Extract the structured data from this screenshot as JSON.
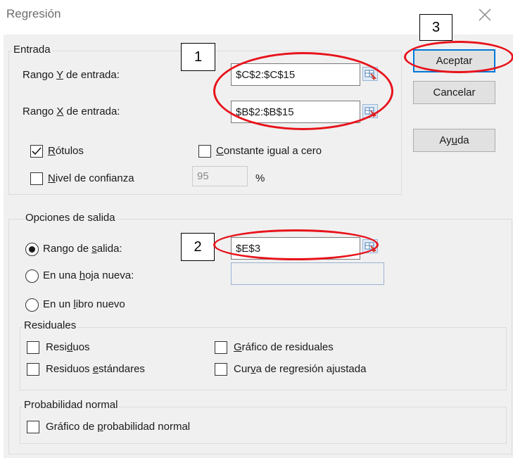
{
  "window": {
    "title": "Regresión"
  },
  "input_group": {
    "legend": "Entrada",
    "y_range": {
      "label_pre": "Rango ",
      "label_key": "Y",
      "label_post": " de entrada:",
      "value": "$C$2:$C$15"
    },
    "x_range": {
      "label_pre": "Rango ",
      "label_key": "X",
      "label_post": " de entrada:",
      "value": "$B$2:$B$15"
    },
    "labels_checkbox": {
      "label_key": "R",
      "label_rest": "ótulos",
      "checked": true
    },
    "constant_zero_checkbox": {
      "label_key": "C",
      "label_rest": "onstante igual a cero",
      "checked": false
    },
    "confidence_checkbox": {
      "label_key": "N",
      "label_rest": "ivel de confianza",
      "checked": false
    },
    "confidence_value": "95",
    "percent_sign": "%"
  },
  "buttons": {
    "accept": "Aceptar",
    "cancel": "Cancelar",
    "help_pre": "Ay",
    "help_key": "u",
    "help_post": "da"
  },
  "output_group": {
    "legend": "Opciones de salida",
    "output_range": {
      "label_pre": "Rango de ",
      "label_key": "s",
      "label_post": "alida:",
      "value": "$E$3",
      "selected": true
    },
    "new_sheet": {
      "label_pre": "En una ",
      "label_key": "h",
      "label_post": "oja nueva:",
      "value": "",
      "selected": false
    },
    "new_book": {
      "label_pre": "En un ",
      "label_key": "l",
      "label_post": "ibro nuevo",
      "selected": false
    }
  },
  "residuals_group": {
    "legend": "Residuales",
    "residuals": {
      "label_pre": "Resi",
      "label_key": "d",
      "label_post": "uos",
      "checked": false
    },
    "std_residuals": {
      "label_pre": "Residuos ",
      "label_key": "e",
      "label_post": "stándares",
      "checked": false
    },
    "residual_plot": {
      "label_pre": "",
      "label_key": "G",
      "label_post": "ráfico de residuales",
      "checked": false
    },
    "fit_line_plot": {
      "label_pre": "Cur",
      "label_key": "v",
      "label_post": "a de regresión ajustada",
      "checked": false
    }
  },
  "normal_group": {
    "legend": "Probabilidad normal",
    "normal_plot": {
      "label_pre": "Gráfico de ",
      "label_key": "p",
      "label_post": "robabilidad normal",
      "checked": false
    }
  },
  "annotations": {
    "callout_1": "1",
    "callout_2": "2",
    "callout_3": "3"
  },
  "colors": {
    "highlight_oval": "#e8131b",
    "default_button_border": "#0078d7"
  }
}
